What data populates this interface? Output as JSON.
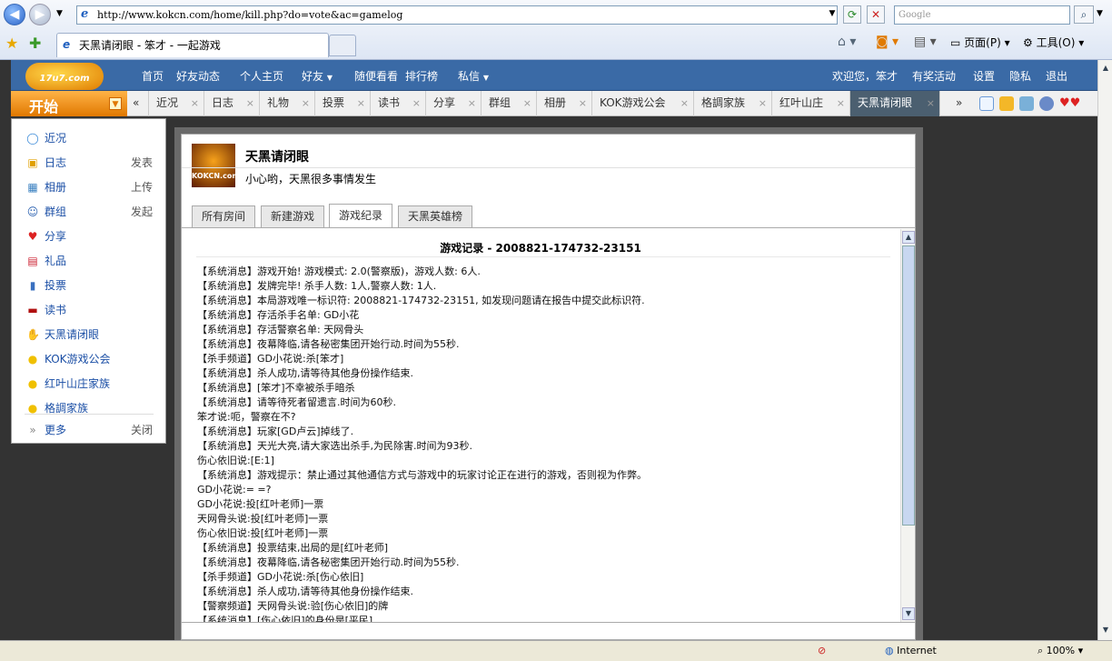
{
  "browser": {
    "url": "http://www.kokcn.com/home/kill.php?do=vote&ac=gamelog",
    "search_placeholder": "Google",
    "tab_title": "天黑请闭眼 - 笨才 - 一起游戏",
    "page_menu": "页面(P)",
    "tools_menu": "工具(O)",
    "status_zone": "Internet",
    "zoom": "100%"
  },
  "site": {
    "logo_text": "17u7.com",
    "nav": [
      "首页",
      "好友动态",
      "个人主页",
      "好友",
      "随便看看",
      "排行榜",
      "私信"
    ],
    "welcome": "欢迎您，笨才",
    "right_links": [
      "有奖活动",
      "设置",
      "隐私",
      "退出"
    ]
  },
  "tabs": {
    "start": "开始",
    "items": [
      "近况",
      "日志",
      "礼物",
      "投票",
      "读书",
      "分享",
      "群组",
      "相册",
      "KOK游戏公会",
      "格調家族",
      "红叶山庄",
      "天黑请闭眼"
    ]
  },
  "menu": {
    "items": [
      {
        "label": "近况",
        "side": "",
        "icon": "◯"
      },
      {
        "label": "日志",
        "side": "发表",
        "icon": "▣"
      },
      {
        "label": "相册",
        "side": "上传",
        "icon": "▦"
      },
      {
        "label": "群组",
        "side": "发起",
        "icon": "☺"
      },
      {
        "label": "分享",
        "side": "",
        "icon": "♥"
      },
      {
        "label": "礼品",
        "side": "",
        "icon": "▤"
      },
      {
        "label": "投票",
        "side": "",
        "icon": "▮"
      },
      {
        "label": "读书",
        "side": "",
        "icon": "▬"
      },
      {
        "label": "天黑请闭眼",
        "side": "",
        "icon": "✋"
      },
      {
        "label": "KOK游戏公会",
        "side": "",
        "icon": "●"
      },
      {
        "label": "红叶山庄家族",
        "side": "",
        "icon": "●"
      },
      {
        "label": "格調家族",
        "side": "",
        "icon": "●"
      }
    ],
    "more": "更多",
    "close": "关闭"
  },
  "app": {
    "avatar_text": "KOKCN.com",
    "title": "天黑请闭眼",
    "desc": "小心哟，天黑很多事情发生",
    "tabs": [
      "所有房间",
      "新建游戏",
      "游戏纪录",
      "天黑英雄榜"
    ],
    "active_tab": "游戏纪录"
  },
  "log": {
    "title": "游戏记录  - 2008821-174732-23151",
    "lines": [
      "【系统消息】游戏开始! 游戏模式: 2.0(警察版)，游戏人数: 6人.",
      "【系统消息】发牌完毕! 杀手人数: 1人,警察人数: 1人.",
      "【系统消息】本局游戏唯一标识符: 2008821-174732-23151, 如发现问题请在报告中提交此标识符.",
      "【系统消息】存活杀手名单: GD小花",
      "【系统消息】存活警察名单: 天网骨头",
      "【系统消息】夜幕降临,请各秘密集团开始行动.时间为55秒.",
      "【杀手频道】GD小花说:杀[笨才]",
      "【系统消息】杀人成功,请等待其他身份操作结束.",
      "【系统消息】[笨才]不幸被杀手暗杀",
      "【系统消息】请等待死者留遗言.时间为60秒.",
      "笨才说:呃，警察在不?",
      "【系统消息】玩家[GD卢云]掉线了.",
      "【系统消息】天光大亮,请大家选出杀手,为民除害.时间为93秒.",
      "伤心依旧说:[E:1]",
      "【系统消息】游戏提示：禁止通过其他通信方式与游戏中的玩家讨论正在进行的游戏，否则视为作弊。",
      "GD小花说:= =?",
      "GD小花说:投[红叶老师]一票",
      "天网骨头说:投[红叶老师]一票",
      "伤心依旧说:投[红叶老师]一票",
      "【系统消息】投票结束,出局的是[红叶老师]",
      "【系统消息】夜幕降临,请各秘密集团开始行动.时间为55秒.",
      "【杀手频道】GD小花说:杀[伤心依旧]",
      "【系统消息】杀人成功,请等待其他身份操作结束.",
      "【警察频道】天网骨头说:验[伤心依旧]的牌",
      "【系统消息】[伤心依旧]的身份是[平民]"
    ]
  },
  "colors": {
    "site_bar": "#3a6aa6",
    "start_orange": "#e07800",
    "active_tab": "#4b5f70",
    "link_blue": "#1a4ea5"
  }
}
